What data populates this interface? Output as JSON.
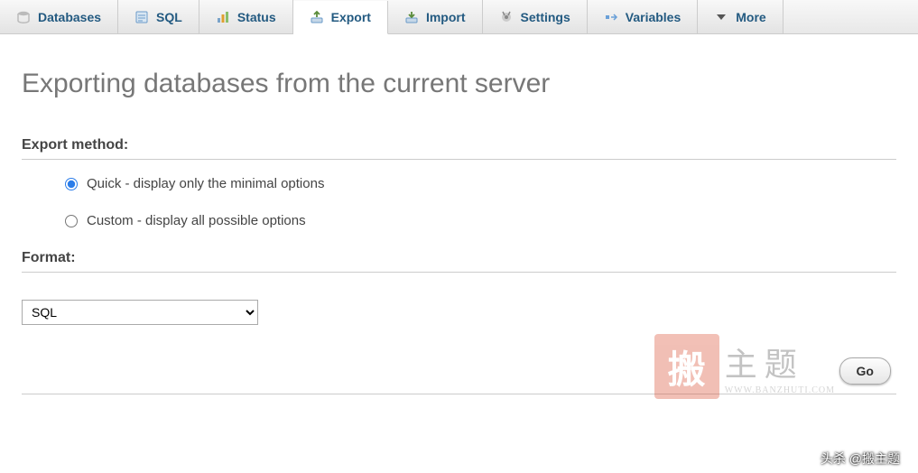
{
  "tabs": [
    {
      "label": "Databases",
      "icon": "database-icon"
    },
    {
      "label": "SQL",
      "icon": "sql-icon"
    },
    {
      "label": "Status",
      "icon": "status-icon"
    },
    {
      "label": "Export",
      "icon": "export-icon"
    },
    {
      "label": "Import",
      "icon": "import-icon"
    },
    {
      "label": "Settings",
      "icon": "settings-icon"
    },
    {
      "label": "Variables",
      "icon": "variables-icon"
    },
    {
      "label": "More",
      "icon": "more-icon"
    }
  ],
  "page_title": "Exporting databases from the current server",
  "export_method": {
    "title": "Export method:",
    "quick_label": "Quick - display only the minimal options",
    "custom_label": "Custom - display all possible options"
  },
  "format": {
    "title": "Format:",
    "selected": "SQL"
  },
  "go_label": "Go",
  "watermark": {
    "seal": "搬",
    "cn": "主题",
    "url": "WWW.BANZHUTI.COM"
  },
  "footer_credit": "头杀 @搬主题"
}
